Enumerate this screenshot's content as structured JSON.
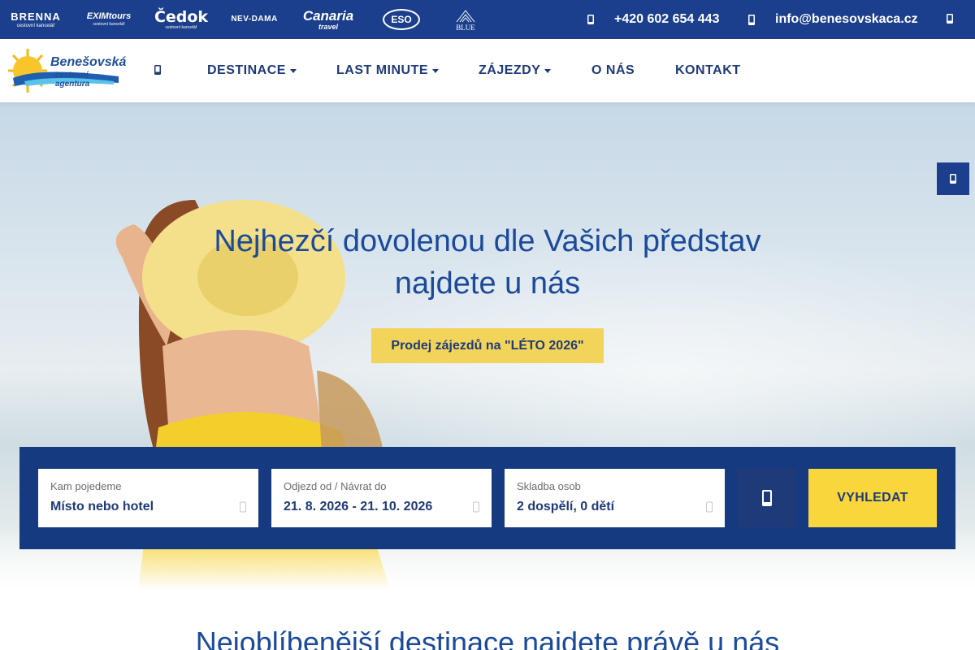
{
  "colors": {
    "primary": "#1b3f8c",
    "search_panel": "#163a80",
    "accent_yellow": "#f9d63c",
    "banner_button": "#f2d45a",
    "text_blue": "#1b4a9a"
  },
  "topbar": {
    "partners": [
      {
        "name": "BRENNA",
        "sub": "cestovní kancelář"
      },
      {
        "name": "EXIMtours",
        "sub": "cestovní kancelář"
      },
      {
        "name": "Čedok",
        "sub": "cestovní kancelář"
      },
      {
        "name": "NEV-DAMA",
        "sub": ""
      },
      {
        "name": "Canaria",
        "sub": "travel"
      },
      {
        "name": "ESO",
        "sub": ""
      },
      {
        "name": "BLUE",
        "sub": ""
      }
    ],
    "phone": "+420 602 654 443",
    "email": "info@benesovskaca.cz",
    "icons": [
      "phone-icon",
      "mail-icon",
      "user-icon"
    ]
  },
  "header": {
    "logo_title": "Benešovská",
    "logo_subtitle": "cestovní agentura",
    "nav": [
      "DESTINACE",
      "LAST MINUTE",
      "ZÁJEZDY",
      "O NÁS",
      "KONTAKT"
    ]
  },
  "hero": {
    "title_line1": "Nejhezčí dovolenou dle Vašich představ",
    "title_line2": "najdete u nás",
    "button": "Prodej zájezdů na \"LÉTO 2026\""
  },
  "search": {
    "destination": {
      "label": "Kam pojedeme",
      "value": "Místo nebo hotel"
    },
    "dates": {
      "label": "Odjezd od / Návrat do",
      "value": "21. 8. 2026 - 21. 10. 2026"
    },
    "persons": {
      "label": "Skladba osob",
      "value": "2 dospělí, 0 dětí"
    },
    "submit": "VYHLEDAT"
  },
  "section": {
    "title": "Nejoblíbenější destinace najdete právě u nás"
  }
}
